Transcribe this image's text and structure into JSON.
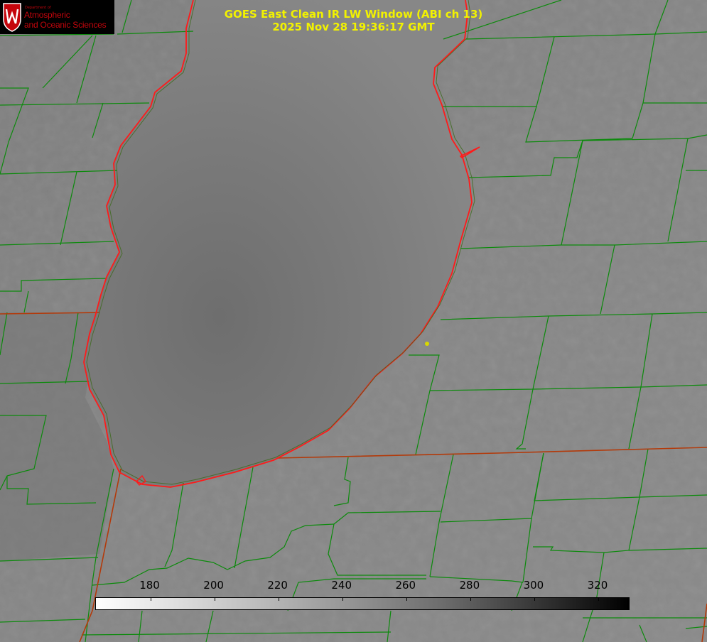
{
  "logo": {
    "department": "Department of",
    "line1": "Atmospheric",
    "line2": "and Oceanic Sciences"
  },
  "title": {
    "line1": "GOES East Clean IR LW Window (ABI ch 13)",
    "line2": "2025 Nov 28 19:36:17 GMT"
  },
  "colorbar": {
    "min": 163,
    "max": 330,
    "ticks": [
      180,
      200,
      220,
      240,
      260,
      280,
      300,
      320
    ],
    "tick_labels": [
      "180",
      "200",
      "220",
      "240",
      "260",
      "280",
      "300",
      "320"
    ]
  },
  "colors": {
    "county_lines": "#0c8a0c",
    "lake_outline": "#ff1a1a",
    "state_lines": "#b33a0a",
    "title_text": "#f2f200",
    "marker": "#d8d800"
  }
}
